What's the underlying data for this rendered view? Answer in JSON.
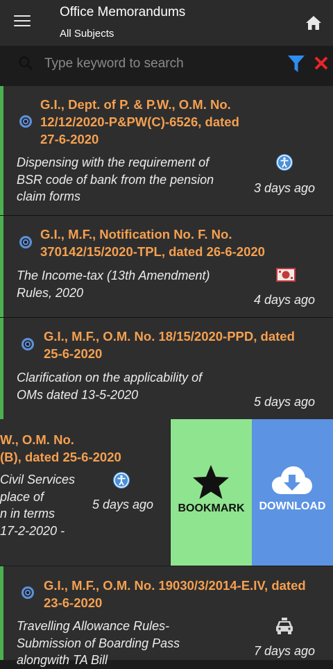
{
  "appbar": {
    "title": "Office Memorandums",
    "subtitle": "All Subjects",
    "menu_icon": "hamburger-menu-icon",
    "home_icon": "home-icon"
  },
  "search": {
    "placeholder": "Type keyword to search",
    "value": "",
    "filter_icon": "filter-icon",
    "clear_icon": "close-icon",
    "filter_color": "#2f8cf0",
    "clear_color": "#e8252b"
  },
  "colors": {
    "accent_heading": "#f5a050",
    "card_stripe": "#4caf50",
    "bookmark_bg": "#8fe48f",
    "download_bg": "#5c93e3"
  },
  "items": [
    {
      "heading": [
        "G.I., Dept. of P. & P.W., O.M. No.",
        "12/12/2020-P&PW(C)-6526, dated",
        "27-6-2020"
      ],
      "desc": [
        "Dispensing with the requirement of",
        "BSR code of bank from the pension",
        "claim forms"
      ],
      "time": "3 days ago",
      "category_icon": "accessibility-icon"
    },
    {
      "heading": [
        "G.I., M.F., Notification No. F. No.",
        "370142/15/2020-TPL, dated 26-6-2020"
      ],
      "desc": [
        "The Income-tax (13th Amendment)",
        "Rules, 2020"
      ],
      "time": "4 days ago",
      "category_icon": "money-icon"
    },
    {
      "heading": [
        "G.I., M.F., O.M. No. 18/15/2020-PPD, dated",
        "25-6-2020"
      ],
      "desc": [
        "Clarification on the applicability of",
        "OMs dated 13-5-2020"
      ],
      "time": "5 days ago",
      "category_icon": ""
    },
    {
      "heading": [
        "W., O.M. No.",
        "(B), dated 25-6-2020"
      ],
      "desc": [
        "Civil Services",
        "place of",
        "n in terms",
        "17-2-2020 -"
      ],
      "time": "5 days ago",
      "category_icon": "accessibility-icon"
    },
    {
      "heading": [
        "G.I., M.F., O.M. No. 19030/3/2014-E.IV, dated",
        "23-6-2020"
      ],
      "desc": [
        "Travelling Allowance Rules-",
        "Submission of Boarding Pass",
        "alongwith TA Bill"
      ],
      "time": "7 days ago",
      "category_icon": "taxi-icon"
    }
  ],
  "swipe_actions": {
    "bookmark_label": "BOOKMARK",
    "bookmark_icon": "star-icon",
    "download_label": "DOWNLOAD",
    "download_icon": "cloud-download-icon"
  }
}
